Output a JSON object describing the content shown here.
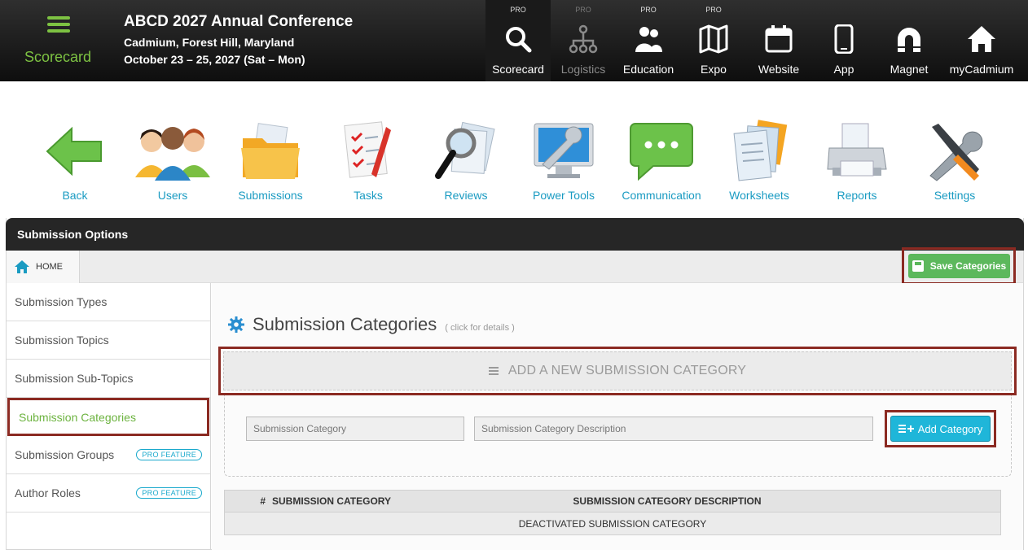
{
  "brand": {
    "label": "Scorecard"
  },
  "conference": {
    "title": "ABCD 2027 Annual Conference",
    "location": "Cadmium, Forest Hill, Maryland",
    "dates": "October 23 – 25, 2027 (Sat – Mon)"
  },
  "topnav": [
    {
      "label": "Scorecard",
      "badge": "PRO",
      "icon": "search-icon"
    },
    {
      "label": "Logistics",
      "badge": "PRO",
      "icon": "hierarchy-icon"
    },
    {
      "label": "Education",
      "badge": "PRO",
      "icon": "people-icon"
    },
    {
      "label": "Expo",
      "badge": "PRO",
      "icon": "map-icon"
    },
    {
      "label": "Website",
      "badge": "",
      "icon": "calendar-icon"
    },
    {
      "label": "App",
      "badge": "",
      "icon": "phone-icon"
    },
    {
      "label": "Magnet",
      "badge": "",
      "icon": "magnet-icon"
    },
    {
      "label": "myCadmium",
      "badge": "",
      "icon": "home-icon"
    }
  ],
  "toolbar": [
    {
      "label": "Back",
      "icon": "back-arrow-icon"
    },
    {
      "label": "Users",
      "icon": "users-icon"
    },
    {
      "label": "Submissions",
      "icon": "folder-icon"
    },
    {
      "label": "Tasks",
      "icon": "checklist-icon"
    },
    {
      "label": "Reviews",
      "icon": "magnifier-icon"
    },
    {
      "label": "Power Tools",
      "icon": "monitor-wrench-icon"
    },
    {
      "label": "Communication",
      "icon": "chat-bubble-icon"
    },
    {
      "label": "Worksheets",
      "icon": "documents-icon"
    },
    {
      "label": "Reports",
      "icon": "printer-icon"
    },
    {
      "label": "Settings",
      "icon": "tools-icon"
    }
  ],
  "panel": {
    "title": "Submission Options",
    "breadcrumb_home": "HOME",
    "save_label": "Save Categories"
  },
  "sidebar": {
    "items": [
      {
        "label": "Submission Types",
        "badge": ""
      },
      {
        "label": "Submission Topics",
        "badge": ""
      },
      {
        "label": "Submission Sub-Topics",
        "badge": ""
      },
      {
        "label": "Submission Categories",
        "badge": ""
      },
      {
        "label": "Submission Groups",
        "badge": "PRO FEATURE"
      },
      {
        "label": "Author Roles",
        "badge": "PRO FEATURE"
      }
    ],
    "active_index": 3
  },
  "main": {
    "title": "Submission Categories",
    "hint": "( click for details )",
    "add_new_label": "ADD A NEW SUBMISSION CATEGORY",
    "category_placeholder": "Submission Category",
    "description_placeholder": "Submission Category Description",
    "add_button_label": "Add Category",
    "table": {
      "headers": [
        "#",
        "SUBMISSION CATEGORY",
        "SUBMISSION CATEGORY DESCRIPTION"
      ],
      "deactivated_row": "DEACTIVATED SUBMISSION CATEGORY"
    }
  },
  "colors": {
    "accent_green": "#7dc242",
    "link_blue": "#1a9bc2",
    "highlight_frame": "#8b2a22",
    "save_green": "#5cb85c",
    "add_blue": "#1fb6d9"
  }
}
